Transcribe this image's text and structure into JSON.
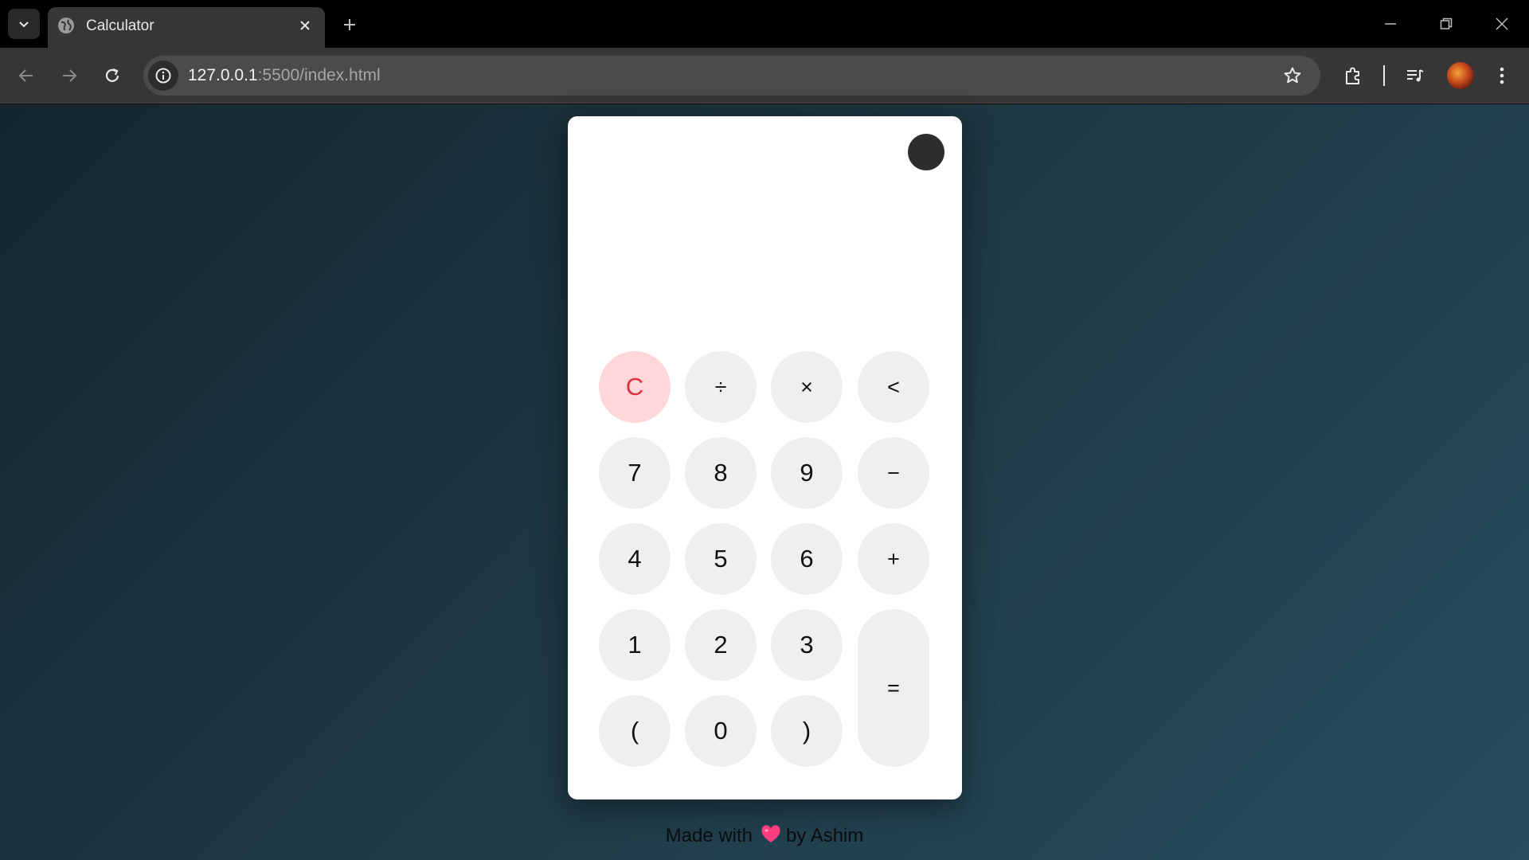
{
  "browser": {
    "tab": {
      "title": "Calculator"
    },
    "address_bar": {
      "host": "127.0.0.1",
      "rest": ":5500/index.html"
    }
  },
  "calculator": {
    "display": "",
    "keys": {
      "clear": "C",
      "divide": "÷",
      "multiply": "×",
      "backspace": "<",
      "seven": "7",
      "eight": "8",
      "nine": "9",
      "minus": "−",
      "four": "4",
      "five": "5",
      "six": "6",
      "plus": "+",
      "one": "1",
      "two": "2",
      "three": "3",
      "equals": "=",
      "open_paren": "(",
      "zero": "0",
      "close_paren": ")"
    }
  },
  "footer": {
    "prefix": "Made with",
    "suffix": "by Ashim"
  },
  "colors": {
    "clear_bg": "#ffd7da",
    "clear_text": "#e0303d",
    "key_bg": "#efefef",
    "heart": "#ff3d7f"
  },
  "icons": [
    "tab-list-icon",
    "globe-icon",
    "close-icon",
    "plus-icon",
    "minimize-icon",
    "restore-icon",
    "window-close-icon",
    "back-arrow-icon",
    "forward-arrow-icon",
    "reload-icon",
    "site-info-icon",
    "star-icon",
    "extensions-icon",
    "media-queue-icon",
    "more-vert-icon",
    "heart-icon"
  ]
}
